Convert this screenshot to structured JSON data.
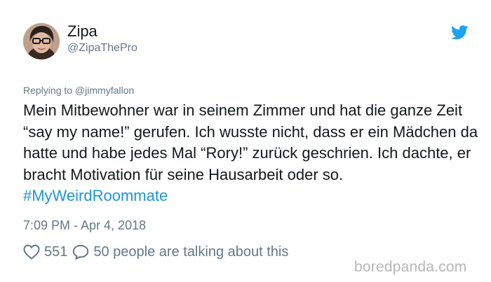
{
  "author": {
    "display_name": "Zipa",
    "handle": "@ZipaThePro"
  },
  "reply_context": "Replying to @jimmyfallon",
  "tweet": {
    "text": "Mein Mitbewohner war in seinem Zimmer und hat die ganze Zeit “say my name!” gerufen. Ich wusste nicht, dass er ein Mädchen da hatte und habe jedes Mal “Rory!” zurück geschrien. Ich dachte, er bracht Motivation für seine Hausarbeit oder so.",
    "hashtag": "#MyWeirdRoommate"
  },
  "timestamp": "7:09 PM - Apr 4, 2018",
  "engagement": {
    "likes": "551",
    "talking": "50 people are talking about this"
  },
  "watermark": "boredpanda.com",
  "icons": {
    "brand": "twitter-bird-icon",
    "like": "heart-icon",
    "reply": "comment-icon"
  },
  "colors": {
    "twitter_blue": "#1da1f2",
    "hashtag": "#1b95e0",
    "secondary_text": "#657786",
    "primary_text": "#14171a",
    "watermark": "#b7b7b7"
  }
}
